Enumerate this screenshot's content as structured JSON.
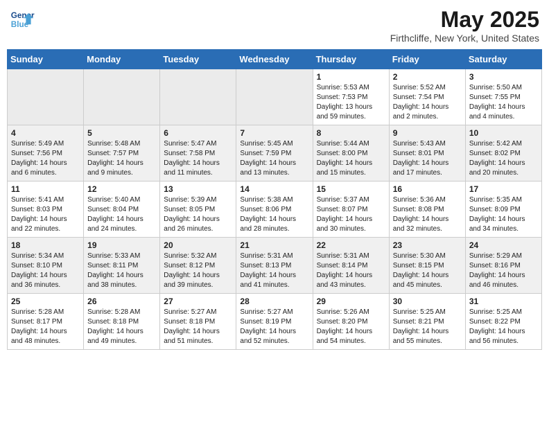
{
  "header": {
    "logo_line1": "General",
    "logo_line2": "Blue",
    "month_title": "May 2025",
    "location": "Firthcliffe, New York, United States"
  },
  "weekdays": [
    "Sunday",
    "Monday",
    "Tuesday",
    "Wednesday",
    "Thursday",
    "Friday",
    "Saturday"
  ],
  "weeks": [
    [
      {
        "day": "",
        "empty": true
      },
      {
        "day": "",
        "empty": true
      },
      {
        "day": "",
        "empty": true
      },
      {
        "day": "",
        "empty": true
      },
      {
        "day": "1",
        "sunrise": "5:53 AM",
        "sunset": "7:53 PM",
        "daylight": "13 hours and 59 minutes."
      },
      {
        "day": "2",
        "sunrise": "5:52 AM",
        "sunset": "7:54 PM",
        "daylight": "14 hours and 2 minutes."
      },
      {
        "day": "3",
        "sunrise": "5:50 AM",
        "sunset": "7:55 PM",
        "daylight": "14 hours and 4 minutes."
      }
    ],
    [
      {
        "day": "4",
        "sunrise": "5:49 AM",
        "sunset": "7:56 PM",
        "daylight": "14 hours and 6 minutes."
      },
      {
        "day": "5",
        "sunrise": "5:48 AM",
        "sunset": "7:57 PM",
        "daylight": "14 hours and 9 minutes."
      },
      {
        "day": "6",
        "sunrise": "5:47 AM",
        "sunset": "7:58 PM",
        "daylight": "14 hours and 11 minutes."
      },
      {
        "day": "7",
        "sunrise": "5:45 AM",
        "sunset": "7:59 PM",
        "daylight": "14 hours and 13 minutes."
      },
      {
        "day": "8",
        "sunrise": "5:44 AM",
        "sunset": "8:00 PM",
        "daylight": "14 hours and 15 minutes."
      },
      {
        "day": "9",
        "sunrise": "5:43 AM",
        "sunset": "8:01 PM",
        "daylight": "14 hours and 17 minutes."
      },
      {
        "day": "10",
        "sunrise": "5:42 AM",
        "sunset": "8:02 PM",
        "daylight": "14 hours and 20 minutes."
      }
    ],
    [
      {
        "day": "11",
        "sunrise": "5:41 AM",
        "sunset": "8:03 PM",
        "daylight": "14 hours and 22 minutes."
      },
      {
        "day": "12",
        "sunrise": "5:40 AM",
        "sunset": "8:04 PM",
        "daylight": "14 hours and 24 minutes."
      },
      {
        "day": "13",
        "sunrise": "5:39 AM",
        "sunset": "8:05 PM",
        "daylight": "14 hours and 26 minutes."
      },
      {
        "day": "14",
        "sunrise": "5:38 AM",
        "sunset": "8:06 PM",
        "daylight": "14 hours and 28 minutes."
      },
      {
        "day": "15",
        "sunrise": "5:37 AM",
        "sunset": "8:07 PM",
        "daylight": "14 hours and 30 minutes."
      },
      {
        "day": "16",
        "sunrise": "5:36 AM",
        "sunset": "8:08 PM",
        "daylight": "14 hours and 32 minutes."
      },
      {
        "day": "17",
        "sunrise": "5:35 AM",
        "sunset": "8:09 PM",
        "daylight": "14 hours and 34 minutes."
      }
    ],
    [
      {
        "day": "18",
        "sunrise": "5:34 AM",
        "sunset": "8:10 PM",
        "daylight": "14 hours and 36 minutes."
      },
      {
        "day": "19",
        "sunrise": "5:33 AM",
        "sunset": "8:11 PM",
        "daylight": "14 hours and 38 minutes."
      },
      {
        "day": "20",
        "sunrise": "5:32 AM",
        "sunset": "8:12 PM",
        "daylight": "14 hours and 39 minutes."
      },
      {
        "day": "21",
        "sunrise": "5:31 AM",
        "sunset": "8:13 PM",
        "daylight": "14 hours and 41 minutes."
      },
      {
        "day": "22",
        "sunrise": "5:31 AM",
        "sunset": "8:14 PM",
        "daylight": "14 hours and 43 minutes."
      },
      {
        "day": "23",
        "sunrise": "5:30 AM",
        "sunset": "8:15 PM",
        "daylight": "14 hours and 45 minutes."
      },
      {
        "day": "24",
        "sunrise": "5:29 AM",
        "sunset": "8:16 PM",
        "daylight": "14 hours and 46 minutes."
      }
    ],
    [
      {
        "day": "25",
        "sunrise": "5:28 AM",
        "sunset": "8:17 PM",
        "daylight": "14 hours and 48 minutes."
      },
      {
        "day": "26",
        "sunrise": "5:28 AM",
        "sunset": "8:18 PM",
        "daylight": "14 hours and 49 minutes."
      },
      {
        "day": "27",
        "sunrise": "5:27 AM",
        "sunset": "8:18 PM",
        "daylight": "14 hours and 51 minutes."
      },
      {
        "day": "28",
        "sunrise": "5:27 AM",
        "sunset": "8:19 PM",
        "daylight": "14 hours and 52 minutes."
      },
      {
        "day": "29",
        "sunrise": "5:26 AM",
        "sunset": "8:20 PM",
        "daylight": "14 hours and 54 minutes."
      },
      {
        "day": "30",
        "sunrise": "5:25 AM",
        "sunset": "8:21 PM",
        "daylight": "14 hours and 55 minutes."
      },
      {
        "day": "31",
        "sunrise": "5:25 AM",
        "sunset": "8:22 PM",
        "daylight": "14 hours and 56 minutes."
      }
    ]
  ]
}
